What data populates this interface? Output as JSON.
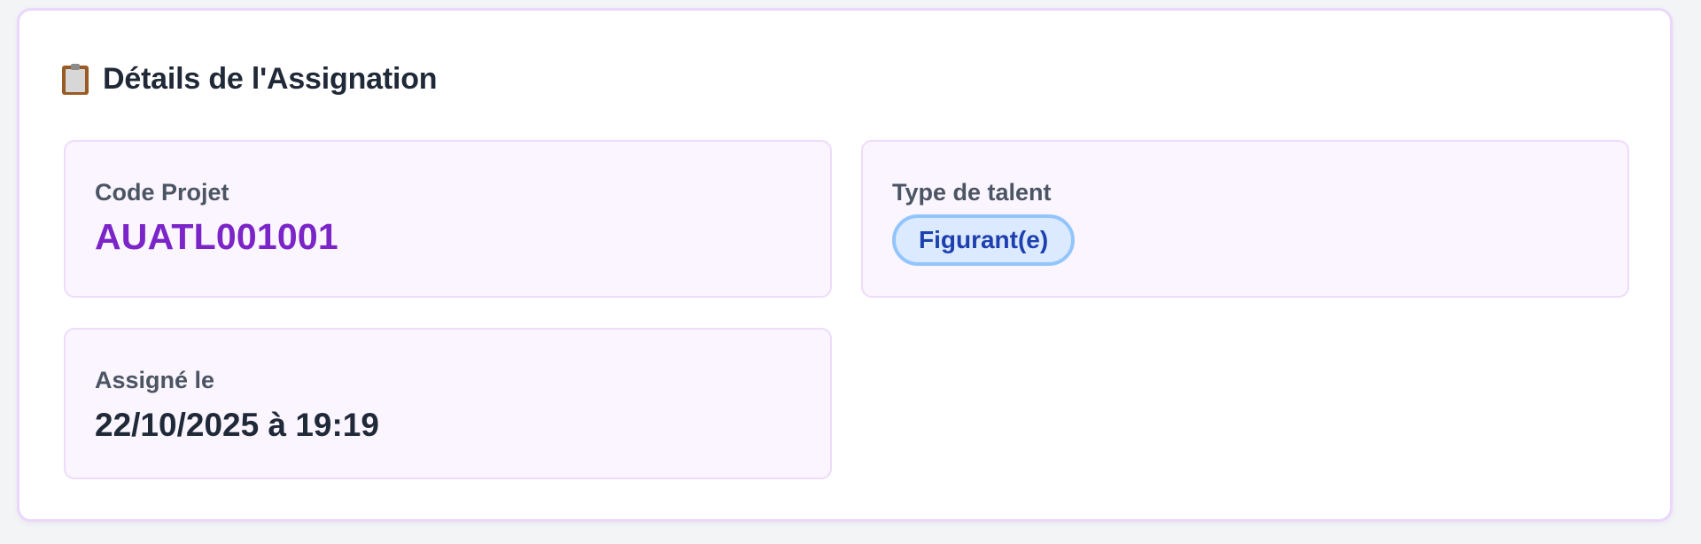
{
  "card": {
    "icon": "clipboard-icon",
    "title": "Détails de l'Assignation"
  },
  "fields": {
    "project_code": {
      "label": "Code Projet",
      "value": "AUATL001001"
    },
    "talent_type": {
      "label": "Type de talent",
      "value": "Figurant(e)"
    },
    "assigned_at": {
      "label": "Assigné le",
      "value": "22/10/2025 à 19:19"
    }
  },
  "colors": {
    "accent_purple": "#7b24c8",
    "badge_background": "#dbeafe",
    "badge_border": "#93c5fd",
    "badge_text": "#1e40af",
    "card_border": "#ead7fb",
    "field_background": "#faf5ff"
  }
}
